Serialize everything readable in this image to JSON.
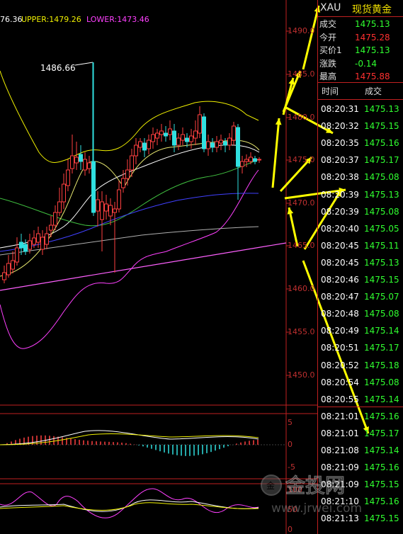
{
  "indicators": {
    "mid_partial": "76.36",
    "upper_label": "UPPER:1479.26",
    "lower_label": "LOWER:1473.46"
  },
  "annotation_high": "1486.66",
  "price_axis": [
    "1490.0",
    "1485.0",
    "1480.0",
    "1475.0",
    "1470.0",
    "1465.0",
    "1460.0",
    "1455.0",
    "1450.0"
  ],
  "macd_axis": [
    "5",
    "0",
    "-5"
  ],
  "kdj_axis": [
    "100",
    "50",
    "0"
  ],
  "quote": {
    "symbol": "XAU",
    "name": "现货黄金",
    "rows": [
      {
        "label": "成交",
        "value": "1475.13",
        "color": "#30ff30"
      },
      {
        "label": "今开",
        "value": "1475.28",
        "color": "#ff3030"
      },
      {
        "label": "买价1",
        "value": "1475.13",
        "color": "#30ff30"
      },
      {
        "label": "涨跌",
        "value": "-0.14",
        "color": "#30ff30"
      },
      {
        "label": "最高",
        "value": "1475.88",
        "color": "#ff3030"
      }
    ]
  },
  "ticks_header": {
    "time": "时间",
    "price": "成交"
  },
  "ticks": [
    {
      "time": "08:20:31",
      "price": "1475.13"
    },
    {
      "time": "08:20:32",
      "price": "1475.15"
    },
    {
      "time": "08:20:35",
      "price": "1475.16"
    },
    {
      "time": "08:20:37",
      "price": "1475.17"
    },
    {
      "time": "08:20:38",
      "price": "1475.08"
    },
    {
      "time": "08:20:39",
      "price": "1475.13"
    },
    {
      "time": "08:20:39",
      "price": "1475.08"
    },
    {
      "time": "08:20:40",
      "price": "1475.05"
    },
    {
      "time": "08:20:45",
      "price": "1475.11"
    },
    {
      "time": "08:20:45",
      "price": "1475.13"
    },
    {
      "time": "08:20:46",
      "price": "1475.15"
    },
    {
      "time": "08:20:47",
      "price": "1475.07"
    },
    {
      "time": "08:20:48",
      "price": "1475.08"
    },
    {
      "time": "08:20:49",
      "price": "1475.14"
    },
    {
      "time": "08:20:51",
      "price": "1475.17"
    },
    {
      "time": "08:20:52",
      "price": "1475.18"
    },
    {
      "time": "08:20:54",
      "price": "1475.08"
    },
    {
      "time": "08:20:55",
      "price": "1475.14"
    },
    {
      "time": "08:21:01",
      "price": "1475.16"
    },
    {
      "time": "08:21:01",
      "price": "1475.17"
    },
    {
      "time": "08:21:08",
      "price": "1475.14"
    },
    {
      "time": "08:21:09",
      "price": "1475.16"
    },
    {
      "time": "08:21:09",
      "price": "1475.15"
    },
    {
      "time": "08:21:10",
      "price": "1475.16"
    },
    {
      "time": "08:21:13",
      "price": "1475.15"
    }
  ],
  "watermark": {
    "logo_text": "金投网",
    "url": "www.jrwei.com"
  },
  "colors": {
    "up": "#ff4040",
    "down": "#30e0e0",
    "upper": "#f0f000",
    "lower": "#ff40ff",
    "mid": "#ffffff",
    "ma_green": "#40c040",
    "ma_blue": "#4040ff",
    "arrow": "#ffff00"
  }
}
